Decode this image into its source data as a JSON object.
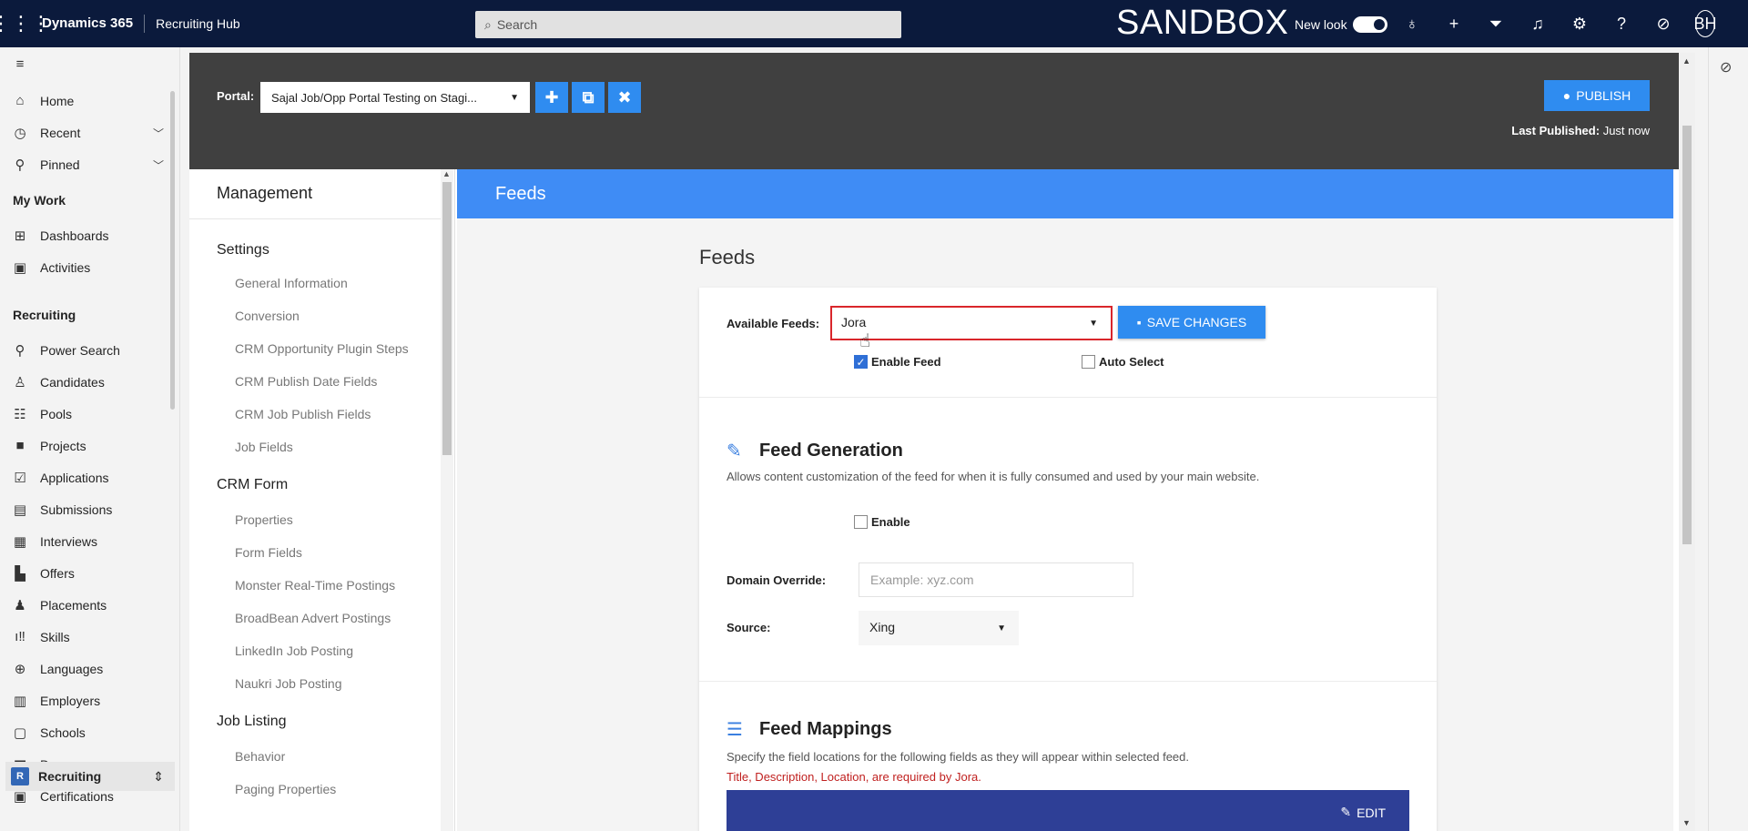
{
  "topbar": {
    "app_name": "Dynamics 365",
    "hub_name": "Recruiting Hub",
    "search_placeholder": "Search",
    "sandbox": "SANDBOX",
    "new_look": "New look",
    "avatar": "BH"
  },
  "leftnav": {
    "items": [
      {
        "label": "Home",
        "icon": "home-icon"
      },
      {
        "label": "Recent",
        "icon": "clock-icon"
      },
      {
        "label": "Pinned",
        "icon": "pin-icon"
      }
    ],
    "my_work_title": "My Work",
    "my_work": [
      {
        "label": "Dashboards",
        "icon": "dashboard-icon"
      },
      {
        "label": "Activities",
        "icon": "activities-icon"
      }
    ],
    "recruiting_title": "Recruiting",
    "recruiting": [
      {
        "label": "Power Search"
      },
      {
        "label": "Candidates"
      },
      {
        "label": "Pools"
      },
      {
        "label": "Projects"
      },
      {
        "label": "Applications"
      },
      {
        "label": "Submissions"
      },
      {
        "label": "Interviews"
      },
      {
        "label": "Offers"
      },
      {
        "label": "Placements"
      },
      {
        "label": "Skills"
      },
      {
        "label": "Languages"
      },
      {
        "label": "Employers"
      },
      {
        "label": "Schools"
      },
      {
        "label": "Degrees"
      },
      {
        "label": "Certifications"
      }
    ],
    "footer": {
      "badge": "R",
      "label": "Recruiting"
    }
  },
  "portal": {
    "label": "Portal:",
    "selected": "Sajal Job/Opp Portal Testing on Stagi...",
    "publish_label": "PUBLISH",
    "last_published_label": "Last Published:",
    "last_published_value": "Just now"
  },
  "management": {
    "title": "Management",
    "groups": [
      {
        "title": "Settings",
        "links": [
          "General Information",
          "Conversion",
          "CRM Opportunity Plugin Steps",
          "CRM Publish Date Fields",
          "CRM Job Publish Fields",
          "Job Fields"
        ]
      },
      {
        "title": "CRM Form",
        "links": [
          "Properties",
          "Form Fields",
          "Monster Real-Time Postings",
          "BroadBean Advert Postings",
          "LinkedIn Job Posting",
          "Naukri Job Posting"
        ]
      },
      {
        "title": "Job Listing",
        "links": [
          "Behavior",
          "Paging Properties"
        ]
      }
    ]
  },
  "feeds": {
    "header": "Feeds",
    "title": "Feeds",
    "available_label": "Available Feeds:",
    "available_value": "Jora",
    "save_label": "SAVE CHANGES",
    "enable_feed": "Enable Feed",
    "auto_select": "Auto Select",
    "generation": {
      "title": "Feed Generation",
      "desc": "Allows content customization of the feed for when it is fully consumed and used by your main website.",
      "enable": "Enable",
      "domain_label": "Domain Override:",
      "domain_placeholder": "Example: xyz.com",
      "source_label": "Source:",
      "source_value": "Xing"
    },
    "mappings": {
      "title": "Feed Mappings",
      "desc": "Specify the field locations for the following fields as they will appear within selected feed.",
      "required": "Title, Description, Location, are required by Jora.",
      "edit_label": "EDIT"
    }
  }
}
